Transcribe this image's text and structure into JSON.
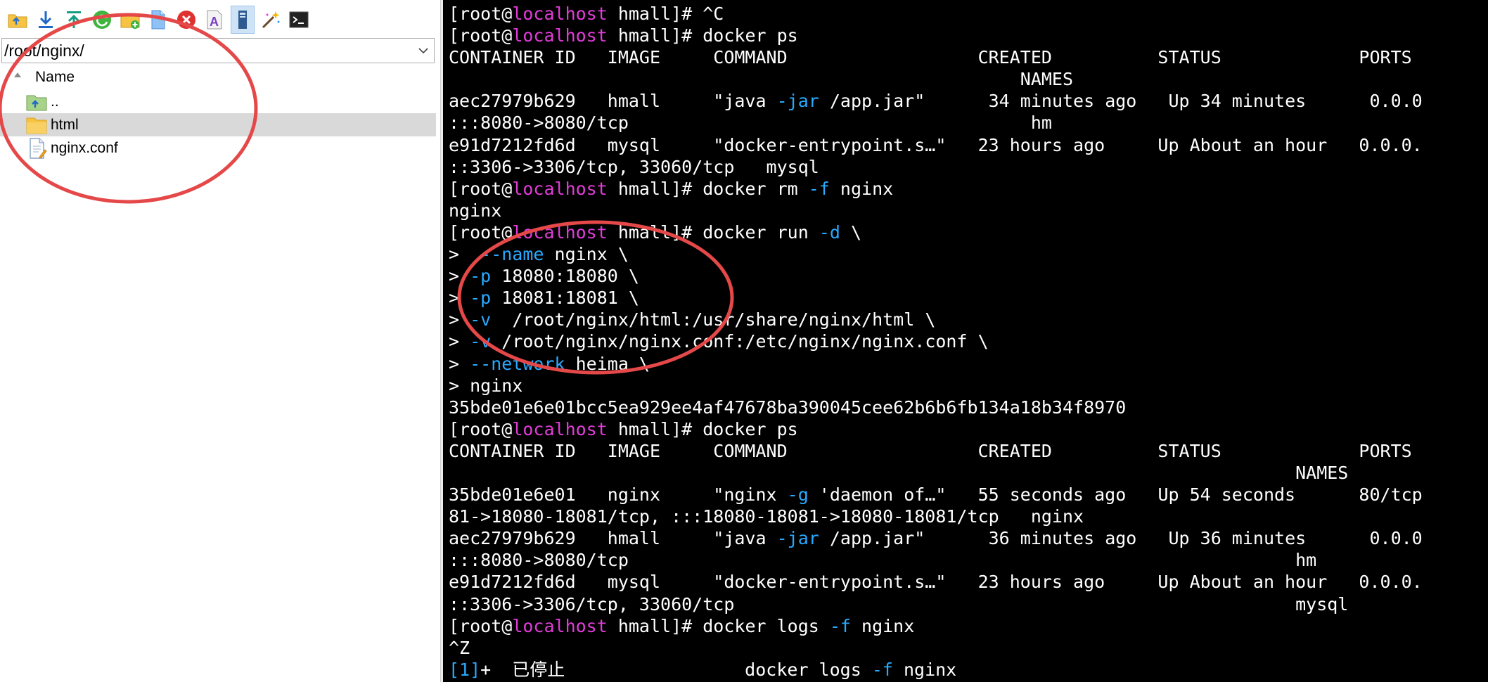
{
  "colors": {
    "prompt_host": "#e23cd9",
    "option_flag": "#29aaff",
    "annotation_circle": "#e54848",
    "selected_row": "#d9d9d9"
  },
  "toolbar": {
    "buttons": [
      {
        "icon": "folder-up-icon",
        "active": false
      },
      {
        "icon": "download-icon",
        "active": false
      },
      {
        "icon": "upload-icon",
        "active": false
      },
      {
        "icon": "refresh-icon",
        "active": false
      },
      {
        "icon": "new-folder-icon",
        "active": false
      },
      {
        "icon": "new-file-icon",
        "active": false
      },
      {
        "icon": "delete-icon",
        "active": false
      },
      {
        "icon": "rename-icon",
        "active": false
      },
      {
        "icon": "properties-icon",
        "active": true
      },
      {
        "icon": "magic-wand-icon",
        "active": false
      },
      {
        "icon": "terminal-icon",
        "active": false
      }
    ]
  },
  "file_panel": {
    "path": "/root/nginx/",
    "column_name": "Name",
    "items": [
      {
        "name": "..",
        "type": "parent",
        "selected": false
      },
      {
        "name": "html",
        "type": "folder",
        "selected": true
      },
      {
        "name": "nginx.conf",
        "type": "file",
        "selected": false
      }
    ]
  },
  "terminal": {
    "lines": [
      [
        {
          "t": "[root@"
        },
        {
          "t": "localhost",
          "c": "host"
        },
        {
          "t": " hmall]# ^C"
        }
      ],
      [
        {
          "t": "[root@"
        },
        {
          "t": "localhost",
          "c": "host"
        },
        {
          "t": " hmall]# docker ps"
        }
      ],
      [
        {
          "t": "CONTAINER ID   IMAGE     COMMAND                  CREATED          STATUS             PORTS"
        }
      ],
      [
        {
          "t": "                                                      NAMES"
        }
      ],
      [
        {
          "t": "aec27979b629   hmall     \"java "
        },
        {
          "t": "-jar",
          "c": "opt"
        },
        {
          "t": " /app.jar\"      34 minutes ago   Up 34 minutes      0.0.0"
        }
      ],
      [
        {
          "t": ":::8080->8080/tcp                                      hm"
        }
      ],
      [
        {
          "t": "e91d7212fd6d   mysql     \"docker-entrypoint.s…\"   23 hours ago     Up About an hour   0.0.0."
        }
      ],
      [
        {
          "t": "::3306->3306/tcp, 33060/tcp   mysql"
        }
      ],
      [
        {
          "t": "[root@"
        },
        {
          "t": "localhost",
          "c": "host"
        },
        {
          "t": " hmall]# docker rm "
        },
        {
          "t": "-f",
          "c": "opt"
        },
        {
          "t": " nginx"
        }
      ],
      [
        {
          "t": "nginx"
        }
      ],
      [
        {
          "t": "[root@"
        },
        {
          "t": "localhost",
          "c": "host"
        },
        {
          "t": " hmall]# docker run "
        },
        {
          "t": "-d",
          "c": "opt"
        },
        {
          "t": " \\"
        }
      ],
      [
        {
          "t": ">  "
        },
        {
          "t": "--name",
          "c": "opt"
        },
        {
          "t": " nginx \\"
        }
      ],
      [
        {
          "t": "> "
        },
        {
          "t": "-p",
          "c": "opt"
        },
        {
          "t": " 18080:18080 \\"
        }
      ],
      [
        {
          "t": "> "
        },
        {
          "t": "-p",
          "c": "opt"
        },
        {
          "t": " 18081:18081 \\"
        }
      ],
      [
        {
          "t": "> "
        },
        {
          "t": "-v",
          "c": "opt"
        },
        {
          "t": "  /root/nginx/html:/usr/share/nginx/html \\"
        }
      ],
      [
        {
          "t": "> "
        },
        {
          "t": "-v",
          "c": "opt"
        },
        {
          "t": " /root/nginx/nginx.conf:/etc/nginx/nginx.conf \\"
        }
      ],
      [
        {
          "t": "> "
        },
        {
          "t": "--network",
          "c": "opt"
        },
        {
          "t": " heima \\"
        }
      ],
      [
        {
          "t": "> nginx"
        }
      ],
      [
        {
          "t": "35bde01e6e01bcc5ea929ee4af47678ba390045cee62b6b6fb134a18b34f8970"
        }
      ],
      [
        {
          "t": "[root@"
        },
        {
          "t": "localhost",
          "c": "host"
        },
        {
          "t": " hmall]# docker ps"
        }
      ],
      [
        {
          "t": "CONTAINER ID   IMAGE     COMMAND                  CREATED          STATUS             PORTS"
        }
      ],
      [
        {
          "t": "                                                                                NAMES"
        }
      ],
      [
        {
          "t": "35bde01e6e01   nginx     \"nginx "
        },
        {
          "t": "-g",
          "c": "opt"
        },
        {
          "t": " 'daemon of…\"   55 seconds ago   Up 54 seconds      80/tcp"
        }
      ],
      [
        {
          "t": "81->18080-18081/tcp, :::18080-18081->18080-18081/tcp   nginx"
        }
      ],
      [
        {
          "t": "aec27979b629   hmall     \"java "
        },
        {
          "t": "-jar",
          "c": "opt"
        },
        {
          "t": " /app.jar\"      36 minutes ago   Up 36 minutes      0.0.0"
        }
      ],
      [
        {
          "t": ":::8080->8080/tcp                                                               hm"
        }
      ],
      [
        {
          "t": "e91d7212fd6d   mysql     \"docker-entrypoint.s…\"   23 hours ago     Up About an hour   0.0.0."
        }
      ],
      [
        {
          "t": "::3306->3306/tcp, 33060/tcp                                                     mysql"
        }
      ],
      [
        {
          "t": "[root@"
        },
        {
          "t": "localhost",
          "c": "host"
        },
        {
          "t": " hmall]# docker logs "
        },
        {
          "t": "-f",
          "c": "opt"
        },
        {
          "t": " nginx"
        }
      ],
      [
        {
          "t": "^Z"
        }
      ],
      [
        {
          "t": "[1]",
          "c": "opt"
        },
        {
          "t": "+  已停止                 docker logs "
        },
        {
          "t": "-f",
          "c": "opt"
        },
        {
          "t": " nginx"
        }
      ]
    ]
  }
}
